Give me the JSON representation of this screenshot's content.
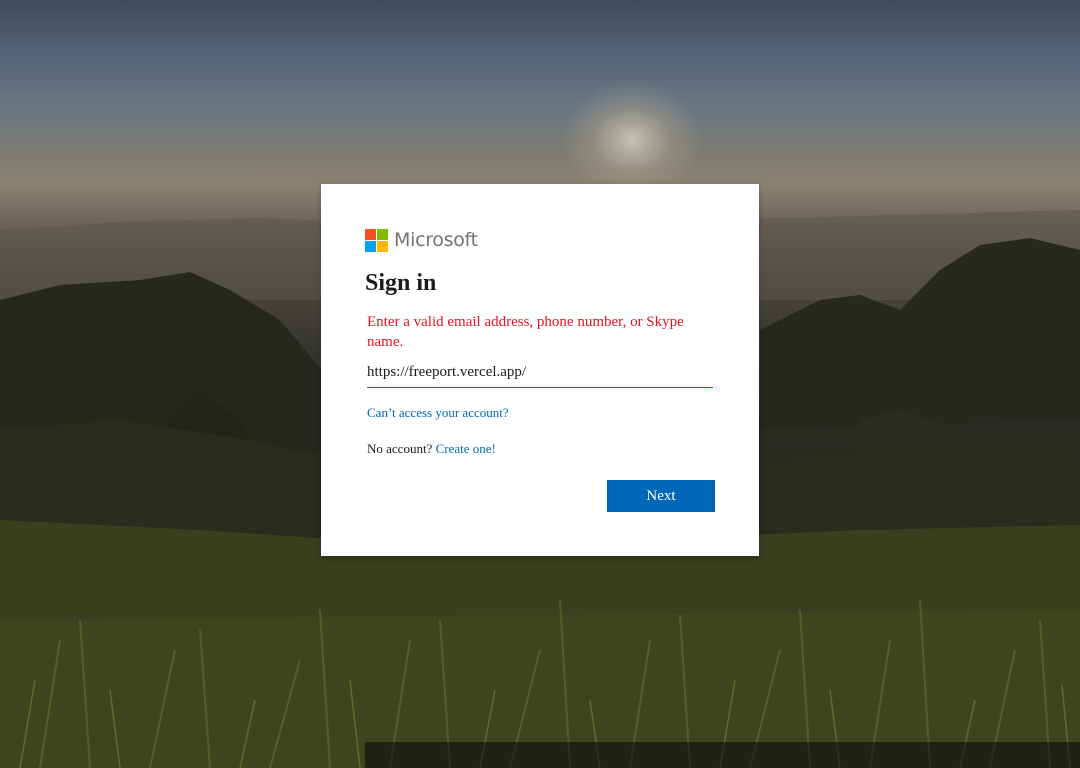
{
  "brand": {
    "name": "Microsoft",
    "logo_colors": [
      "#f25022",
      "#7fba00",
      "#00a4ef",
      "#ffb900"
    ]
  },
  "signin": {
    "title": "Sign in",
    "error": "Enter a valid email address, phone number, or Skype name.",
    "input_value": "https://freeport.vercel.app/",
    "cant_access": "Can’t access your account?",
    "no_account": "No account?",
    "create_one": "Create one!",
    "next": "Next"
  },
  "colors": {
    "accent": "#0067b8",
    "error": "#e81123"
  }
}
